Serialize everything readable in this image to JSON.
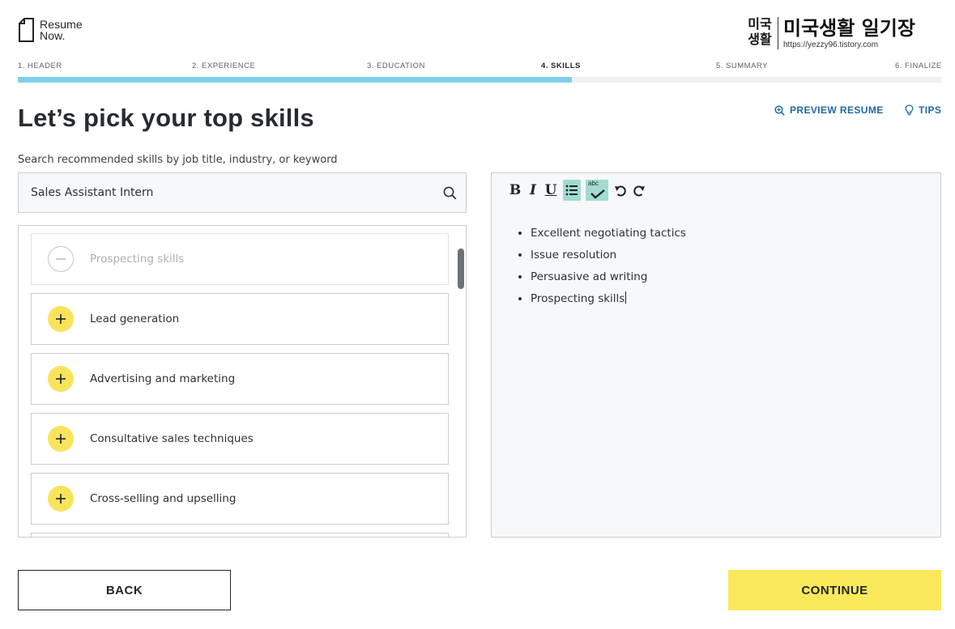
{
  "brand": {
    "line1": "Resume",
    "line2": "Now."
  },
  "watermark": {
    "seal": "미국\n생활",
    "title": "미국생활 일기장",
    "url": "https://yezzy96.tistory.com"
  },
  "steps": [
    {
      "label": "1. HEADER"
    },
    {
      "label": "2. EXPERIENCE"
    },
    {
      "label": "3. EDUCATION"
    },
    {
      "label": "4. SKILLS",
      "active": true
    },
    {
      "label": "5. SUMMARY"
    },
    {
      "label": "6. FINALIZE"
    }
  ],
  "progress": {
    "current_step": 4,
    "total_steps": 6
  },
  "page": {
    "title": "Let’s pick your top skills"
  },
  "links": {
    "preview": "PREVIEW RESUME",
    "tips": "TIPS"
  },
  "search": {
    "label": "Search recommended skills by job title, industry, or keyword",
    "value": "Sales Assistant Intern",
    "icon": "search-icon"
  },
  "skills": [
    {
      "label": "Prospecting skills",
      "added": true
    },
    {
      "label": "Lead generation",
      "added": false
    },
    {
      "label": "Advertising and marketing",
      "added": false
    },
    {
      "label": "Consultative sales techniques",
      "added": false
    },
    {
      "label": "Cross-selling and upselling",
      "added": false
    }
  ],
  "editor": {
    "toolbar": {
      "bold": "B",
      "italic": "I",
      "underline": "U",
      "spell_check_label": "abc"
    },
    "items": [
      "Excellent negotiating tactics",
      "Issue resolution",
      "Persuasive ad writing",
      "Prospecting skills"
    ]
  },
  "footer": {
    "back": "BACK",
    "continue": "CONTINUE"
  },
  "colors": {
    "accent_yellow": "#f9e95a",
    "progress_blue": "#7fd0e6",
    "link_blue": "#1f6aa3",
    "toolbar_active": "#a3dbd0"
  }
}
